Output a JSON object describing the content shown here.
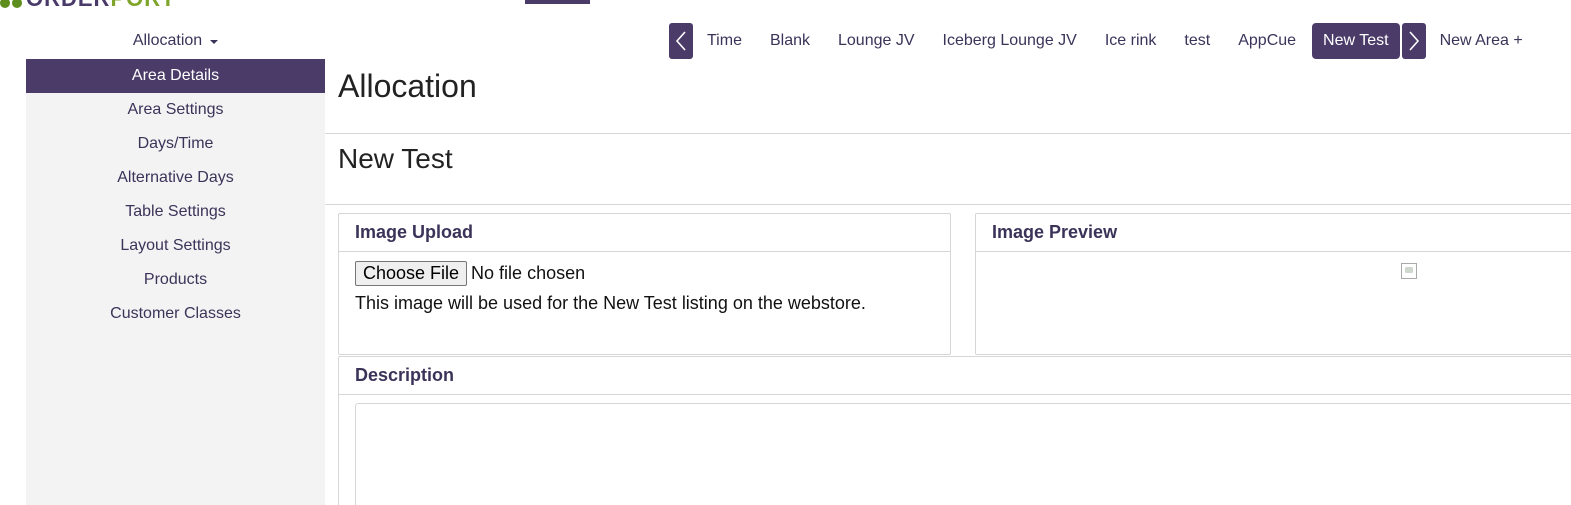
{
  "logo": {
    "text_main": "ORDER",
    "text_accent": "PORT"
  },
  "allocation_dropdown": {
    "label": "Allocation"
  },
  "sidebar": {
    "items": [
      {
        "label": "Area Details",
        "active": true
      },
      {
        "label": "Area Settings"
      },
      {
        "label": "Days/Time"
      },
      {
        "label": "Alternative Days"
      },
      {
        "label": "Table Settings"
      },
      {
        "label": "Layout Settings"
      },
      {
        "label": "Products"
      },
      {
        "label": "Customer Classes"
      }
    ]
  },
  "tabs": {
    "items": [
      "Time",
      "Blank",
      "Lounge JV",
      "Iceberg Lounge JV",
      "Ice rink",
      "test",
      "AppCue"
    ],
    "active": "New Test",
    "new_area": "New Area +",
    "prev_icon": "chevron-left-icon",
    "next_icon": "chevron-right-icon"
  },
  "page": {
    "title": "Allocation",
    "area_name": "New Test"
  },
  "image_upload": {
    "heading": "Image Upload",
    "button_label": "Choose File",
    "file_status": "No file chosen",
    "help_text": "This image will be used for the New Test listing on the webstore."
  },
  "image_preview": {
    "heading": "Image Preview",
    "image_icon": "broken-image-icon"
  },
  "description": {
    "heading": "Description",
    "value": ""
  },
  "colors": {
    "brand_purple": "#4b3b68",
    "brand_green": "#7ea529",
    "sidebar_bg": "#f3f3f3"
  }
}
